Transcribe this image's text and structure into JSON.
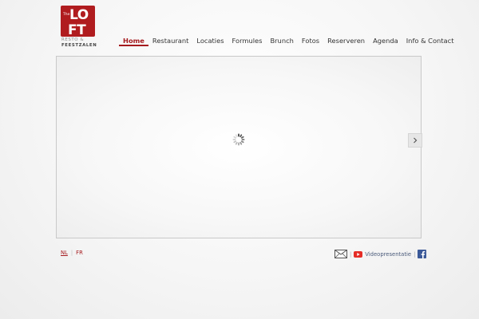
{
  "logo": {
    "main_text_top": "LO",
    "main_text_bottom": "FT",
    "small_text": "The",
    "tagline_line1": "RESTO &",
    "tagline_line2": "FEESTZALEN",
    "brand_color": "#b01c1f"
  },
  "nav": {
    "items": [
      {
        "label": "Home",
        "active": true
      },
      {
        "label": "Restaurant"
      },
      {
        "label": "Locaties"
      },
      {
        "label": "Formules"
      },
      {
        "label": "Brunch"
      },
      {
        "label": "Fotos"
      },
      {
        "label": "Reserveren"
      },
      {
        "label": "Agenda"
      },
      {
        "label": "Info & Contact"
      }
    ]
  },
  "slideshow": {
    "loading_icon": "loading-spinner-icon",
    "next_icon": "chevron-right-icon"
  },
  "footer": {
    "languages": [
      {
        "label": "NL",
        "active": true
      },
      {
        "label": "FR"
      }
    ],
    "separator": "|",
    "mail_icon": "envelope-icon",
    "video_icon": "youtube-icon",
    "video_label": "Videopresentatie",
    "facebook_icon": "facebook-icon"
  },
  "colors": {
    "accent": "#a51a1e",
    "link": "#4a5a7a",
    "facebook": "#3b5998"
  }
}
